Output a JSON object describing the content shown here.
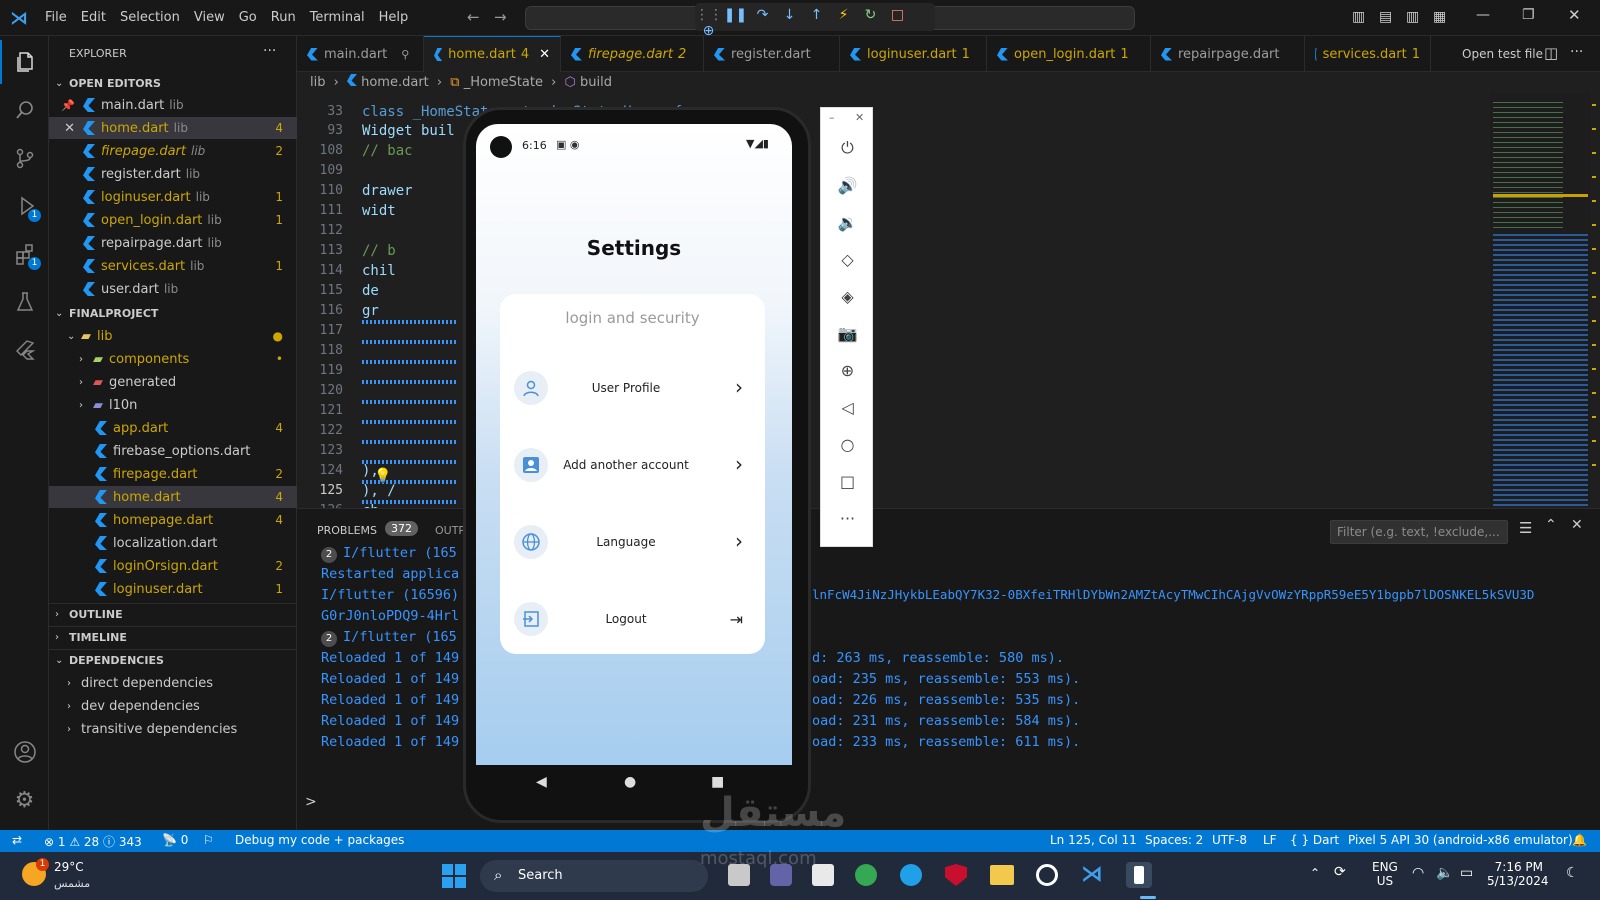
{
  "menu": [
    "File",
    "Edit",
    "Selection",
    "View",
    "Go",
    "Run",
    "Terminal",
    "Help"
  ],
  "explorer": {
    "title": "EXPLORER",
    "more": "···",
    "open_editors": "OPEN EDITORS",
    "open_files": [
      {
        "name": "main.dart",
        "dir": "lib",
        "count": "",
        "style": "normal",
        "mark": "pin"
      },
      {
        "name": "home.dart",
        "dir": "lib",
        "count": "4",
        "style": "yellow",
        "mark": "close"
      },
      {
        "name": "firepage.dart",
        "dir": "lib",
        "count": "2",
        "style": "italic-yellow",
        "mark": ""
      },
      {
        "name": "register.dart",
        "dir": "lib",
        "count": "",
        "style": "normal",
        "mark": ""
      },
      {
        "name": "loginuser.dart",
        "dir": "lib",
        "count": "1",
        "style": "yellow",
        "mark": ""
      },
      {
        "name": "open_login.dart",
        "dir": "lib",
        "count": "1",
        "style": "yellow",
        "mark": ""
      },
      {
        "name": "repairpage.dart",
        "dir": "lib",
        "count": "",
        "style": "normal",
        "mark": ""
      },
      {
        "name": "services.dart",
        "dir": "lib",
        "count": "1",
        "style": "yellow",
        "mark": ""
      },
      {
        "name": "user.dart",
        "dir": "lib",
        "count": "",
        "style": "normal",
        "mark": ""
      }
    ],
    "project": "FINALPROJECT",
    "lib_folder": "lib",
    "tree": [
      {
        "name": "components",
        "type": "folder",
        "count": "•",
        "style": "yellow"
      },
      {
        "name": "generated",
        "type": "folder-red",
        "count": "",
        "style": "normal"
      },
      {
        "name": "l10n",
        "type": "folder-purple",
        "count": "",
        "style": "normal"
      },
      {
        "name": "app.dart",
        "type": "file",
        "count": "4",
        "style": "yellow"
      },
      {
        "name": "firebase_options.dart",
        "type": "file",
        "count": "",
        "style": "normal"
      },
      {
        "name": "firepage.dart",
        "type": "file",
        "count": "2",
        "style": "yellow"
      },
      {
        "name": "home.dart",
        "type": "file",
        "count": "4",
        "style": "yellow"
      },
      {
        "name": "homepage.dart",
        "type": "file",
        "count": "4",
        "style": "yellow"
      },
      {
        "name": "localization.dart",
        "type": "file",
        "count": "",
        "style": "normal"
      },
      {
        "name": "loginOrsign.dart",
        "type": "file",
        "count": "2",
        "style": "yellow"
      },
      {
        "name": "loginuser.dart",
        "type": "file",
        "count": "1",
        "style": "yellow"
      }
    ],
    "outline": "OUTLINE",
    "timeline": "TIMELINE",
    "dependencies": "DEPENDENCIES",
    "deps": [
      "direct dependencies",
      "dev dependencies",
      "transitive dependencies"
    ]
  },
  "tabs": [
    {
      "label": "main.dart",
      "count": "",
      "active": false
    },
    {
      "label": "home.dart",
      "count": "4",
      "active": true
    },
    {
      "label": "firepage.dart",
      "count": "2",
      "active": false
    },
    {
      "label": "register.dart",
      "count": "",
      "active": false
    },
    {
      "label": "loginuser.dart",
      "count": "1",
      "active": false
    },
    {
      "label": "open_login.dart",
      "count": "1",
      "active": false
    },
    {
      "label": "repairpage.dart",
      "count": "",
      "active": false
    },
    {
      "label": "services.dart",
      "count": "1",
      "active": false
    }
  ],
  "open_test_file": "Open test file",
  "breadcrumb": {
    "a": "lib",
    "b": "home.dart",
    "c": "_HomeState",
    "d": "build"
  },
  "code_lines": [
    {
      "n": "33",
      "t": "class _HomeState extends State<Home> {"
    },
    {
      "n": "93",
      "t": "  Widget buil"
    },
    {
      "n": "108",
      "t": "      // bac"
    },
    {
      "n": "109",
      "t": ""
    },
    {
      "n": "110",
      "t": "      drawer"
    },
    {
      "n": "111",
      "t": "        widt"
    },
    {
      "n": "112",
      "t": ""
    },
    {
      "n": "113",
      "t": "        // b"
    },
    {
      "n": "114",
      "t": "        chil"
    },
    {
      "n": "115",
      "t": "          de"
    },
    {
      "n": "116",
      "t": "          gr"
    },
    {
      "n": "117",
      "t": ""
    },
    {
      "n": "118",
      "t": ""
    },
    {
      "n": "119",
      "t": ""
    },
    {
      "n": "120",
      "t": ""
    },
    {
      "n": "121",
      "t": ""
    },
    {
      "n": "122",
      "t": ""
    },
    {
      "n": "123",
      "t": ""
    },
    {
      "n": "124",
      "t": "          ),"
    },
    {
      "n": "125",
      "t": "        ), /"
    },
    {
      "n": "126",
      "t": "          ch"
    }
  ],
  "panel": {
    "problems": "PROBLEMS",
    "problems_count": "372",
    "output": "OUTP",
    "filter_placeholder": "Filter (e.g. text, !exclude,...",
    "lines_left": [
      "I/flutter (165",
      "Restarted applica",
      "I/flutter (16596)",
      "G0rJ0nloPDQ9-4Hrl",
      "I/flutter (165",
      "Reloaded 1 of 149",
      "Reloaded 1 of 149",
      "Reloaded 1 of 149",
      "Reloaded 1 of 149",
      "Reloaded 1 of 149"
    ],
    "lines_right": [
      "",
      "",
      "lnFcW4JiNzJHykbLEabQY7K32-0BXfeiTRHlDYbWn2AMZtAcyTMwCIhCAjgVvOWzYRppR59eE5Y1bgpb7lDOSNKEL5kSVU3D",
      "",
      "",
      "d: 263 ms, reassemble: 580 ms).",
      "oad: 235 ms, reassemble: 553 ms).",
      "oad: 226 ms, reassemble: 535 ms).",
      "oad: 231 ms, reassemble: 584 ms).",
      "oad: 233 ms, reassemble: 611 ms)."
    ],
    "badge_lines": [
      "2",
      "",
      "",
      "",
      "2",
      "",
      "",
      "",
      "",
      ""
    ],
    "prompt": ">"
  },
  "phone": {
    "time": "6:16",
    "title": "Settings",
    "section": "login and security",
    "items": [
      {
        "label": "User Profile",
        "icon": "person-icon",
        "action": "chevron-right-icon"
      },
      {
        "label": "Add another account",
        "icon": "account-box-icon",
        "action": "chevron-right-icon"
      },
      {
        "label": "Language",
        "icon": "globe-icon",
        "action": "chevron-right-icon"
      },
      {
        "label": "Logout",
        "icon": "login-icon",
        "action": "logout-icon"
      }
    ]
  },
  "status": {
    "errors": "1",
    "warnings": "28",
    "info": "343",
    "ports": "0",
    "debug": "Debug my code + packages",
    "position": "Ln 125, Col 11",
    "spaces": "Spaces: 2",
    "encoding": "UTF-8",
    "eol": "LF",
    "language": "Dart",
    "device": "Pixel 5 API 30 (android-x86 emulator)"
  },
  "taskbar": {
    "temp": "29°C",
    "weather": "مشمس",
    "weather_badge": "1",
    "search": "Search",
    "lang1": "ENG",
    "lang2": "US",
    "time": "7:16 PM",
    "date": "5/13/2024"
  },
  "watermark": {
    "ar": "مستقل",
    "latin": "mostaql.com"
  }
}
